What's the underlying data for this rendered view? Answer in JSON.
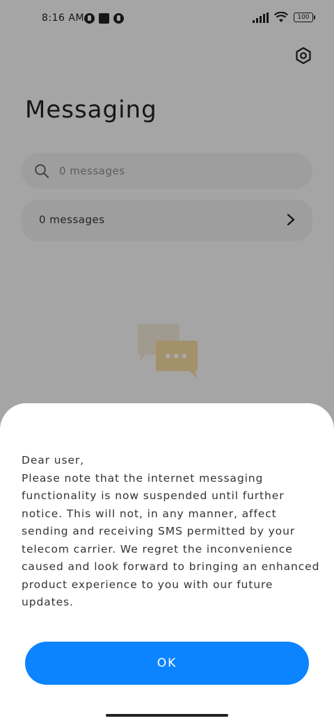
{
  "status_bar": {
    "time": "8:16 AM",
    "battery": "100"
  },
  "header": {
    "title": "Messaging"
  },
  "search": {
    "placeholder": "0 messages"
  },
  "conversation_summary": {
    "label": "0 messages"
  },
  "dialog": {
    "message": "Dear user,\nPlease note that the internet messaging functionality is now suspended until further notice. This will not, in any manner, affect sending and receiving SMS permitted by your telecom carrier. We regret the inconvenience caused and look forward to bringing an enhanced product experience to you with our future updates.",
    "ok_label": "OK"
  },
  "colors": {
    "accent": "#0c84ff",
    "illustration": "#f3d9a0"
  }
}
